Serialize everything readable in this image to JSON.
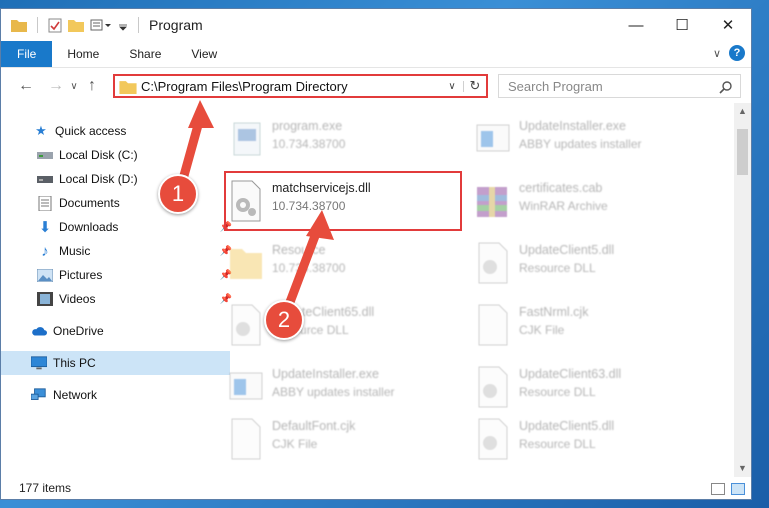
{
  "window": {
    "title": "Program",
    "controls": {
      "minimize": "—",
      "maximize": "☐",
      "close": "✕"
    }
  },
  "ribbon": {
    "tabs": [
      "File",
      "Home",
      "Share",
      "View"
    ],
    "help": "?",
    "expand": "∨"
  },
  "nav": {
    "back": "←",
    "forward": "→",
    "recent": "∨",
    "up": "↑",
    "address": "C:\\Program Files\\Program Directory",
    "address_dropdown": "∨",
    "refresh": "↻",
    "search_placeholder": "Search Program"
  },
  "sidebar": {
    "items": [
      {
        "label": "Quick access",
        "icon": "star-icon"
      },
      {
        "label": "Local Disk (C:)",
        "icon": "drive-icon"
      },
      {
        "label": "Local Disk (D:)",
        "icon": "drive-icon"
      },
      {
        "label": "Documents",
        "icon": "documents-icon"
      },
      {
        "label": "Downloads",
        "icon": "download-icon"
      },
      {
        "label": "Music",
        "icon": "music-icon"
      },
      {
        "label": "Pictures",
        "icon": "pictures-icon"
      },
      {
        "label": "Videos",
        "icon": "videos-icon"
      },
      {
        "label": "OneDrive",
        "icon": "cloud-icon"
      },
      {
        "label": "This PC",
        "icon": "computer-icon"
      },
      {
        "label": "Network",
        "icon": "network-icon"
      }
    ]
  },
  "files": [
    {
      "name": "program.exe",
      "desc": "10.734.38700",
      "icon": "exe-icon"
    },
    {
      "name": "UpdateInstaller.exe",
      "desc": "ABBY updates installer",
      "icon": "exe-icon"
    },
    {
      "name": "matchservicejs.dll",
      "desc": "10.734.38700",
      "icon": "dll-icon"
    },
    {
      "name": "certificates.cab",
      "desc": "WinRAR Archive",
      "icon": "archive-icon"
    },
    {
      "name": "Resource",
      "desc": "10.734.38700",
      "icon": "folder-icon"
    },
    {
      "name": "UpdateClient5.dll",
      "desc": "Resource DLL",
      "icon": "dll-icon"
    },
    {
      "name": "UpdateClient65.dll",
      "desc": "Resource DLL",
      "icon": "dll-icon"
    },
    {
      "name": "FastNrml.cjk",
      "desc": "CJK File",
      "icon": "file-icon"
    },
    {
      "name": "UpdateInstaller.exe",
      "desc": "ABBY updates installer",
      "icon": "exe-icon"
    },
    {
      "name": "UpdateClient63.dll",
      "desc": "Resource DLL",
      "icon": "dll-icon"
    },
    {
      "name": "DefaultFont.cjk",
      "desc": "CJK File",
      "icon": "file-icon"
    },
    {
      "name": "UpdateClient5.dll",
      "desc": "Resource DLL",
      "icon": "dll-icon"
    }
  ],
  "status": {
    "count": "177 items"
  },
  "callouts": [
    "1",
    "2"
  ],
  "colors": {
    "accent": "#1979ca",
    "highlight": "#e23b3b",
    "callout": "#e74c3c"
  }
}
